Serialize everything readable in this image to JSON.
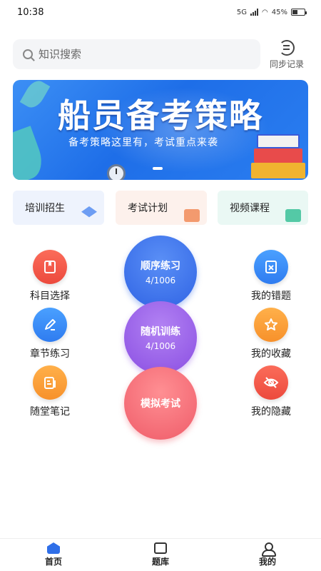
{
  "status_bar": {
    "time": "10:38",
    "network": "5G",
    "battery": "45%"
  },
  "search": {
    "placeholder": "知识搜索"
  },
  "sync": {
    "label": "同步记录"
  },
  "banner": {
    "title": "船员备考策略",
    "subtitle": "备考策略这里有，考试重点来袭"
  },
  "categories": [
    {
      "label": "培训招生",
      "icon": "graduation-cap-icon"
    },
    {
      "label": "考试计划",
      "icon": "plan-icon"
    },
    {
      "label": "视频课程",
      "icon": "video-icon"
    }
  ],
  "left_items": [
    {
      "label": "科目选择",
      "icon": "book-icon"
    },
    {
      "label": "章节练习",
      "icon": "pencil-icon"
    },
    {
      "label": "随堂笔记",
      "icon": "note-icon"
    }
  ],
  "right_items": [
    {
      "label": "我的错题",
      "icon": "wrong-icon"
    },
    {
      "label": "我的收藏",
      "icon": "star-icon"
    },
    {
      "label": "我的隐藏",
      "icon": "hidden-eye-icon"
    }
  ],
  "practice": {
    "sequential": {
      "label": "顺序练习",
      "progress": "4/1006"
    },
    "random": {
      "label": "随机训练",
      "progress": "4/1006"
    },
    "mock": {
      "label": "模拟考试"
    }
  },
  "bottom_nav": [
    {
      "label": "首页",
      "icon": "home-icon",
      "active": true
    },
    {
      "label": "题库",
      "icon": "question-bank-icon"
    },
    {
      "label": "我的",
      "icon": "profile-icon"
    }
  ],
  "colors": {
    "accent": "#2f6fe8",
    "red": "#ec4a3d",
    "purple": "#8a4ee2",
    "pink": "#ef5c69",
    "orange": "#f7912b"
  }
}
